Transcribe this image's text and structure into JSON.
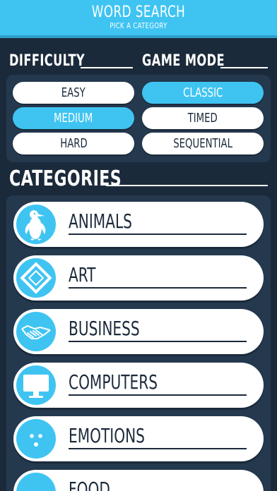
{
  "header": {
    "title": "WORD SEARCH",
    "subtitle": "PICK A CATEGORY"
  },
  "difficulty": {
    "label": "DIFFICULTY",
    "options": [
      "EASY",
      "MEDIUM",
      "HARD"
    ],
    "selected": "MEDIUM"
  },
  "game_mode": {
    "label": "GAME MODE",
    "options": [
      "CLASSIC",
      "TIMED",
      "SEQUENTIAL"
    ],
    "selected": "CLASSIC"
  },
  "categories": {
    "label": "CATEGORIES",
    "items": [
      {
        "label": "ANIMALS",
        "icon": "penguin-icon"
      },
      {
        "label": "ART",
        "icon": "picture-frame-icon"
      },
      {
        "label": "BUSINESS",
        "icon": "handshake-icon"
      },
      {
        "label": "COMPUTERS",
        "icon": "monitor-icon"
      },
      {
        "label": "EMOTIONS",
        "icon": "face-icon"
      },
      {
        "label": "FOOD",
        "icon": "food-icon"
      }
    ]
  },
  "colors": {
    "accent": "#3fc4f2",
    "background": "#1b2a3b",
    "panel": "#24384e",
    "pill": "#ffffff"
  }
}
